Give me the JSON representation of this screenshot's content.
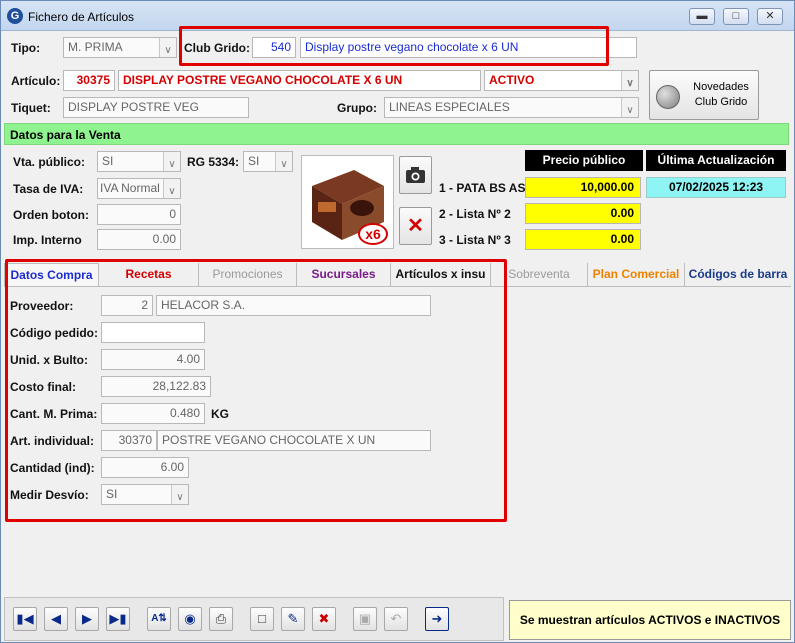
{
  "window": {
    "title": "Fichero de Artículos",
    "app_icon": "app-globe-icon"
  },
  "header": {
    "tipo_label": "Tipo:",
    "tipo_value": "M. PRIMA",
    "club_grido_label": "Club Grido:",
    "club_grido_code": "540",
    "club_grido_desc": "Display postre vegano chocolate x 6 UN"
  },
  "articulo": {
    "label": "Artículo:",
    "code": "30375",
    "description": "DISPLAY POSTRE VEGANO CHOCOLATE X 6 UN",
    "status": "ACTIVO",
    "tiquet_label": "Tiquet:",
    "tiquet_value": "DISPLAY POSTRE VEG",
    "grupo_label": "Grupo:",
    "grupo_value": "LINEAS ESPECIALES",
    "novedades_label": "Novedades Club Grido"
  },
  "venta": {
    "section_title": "Datos para la Venta",
    "vta_publico_label": "Vta. público:",
    "vta_publico_value": "SI",
    "rg_label": "RG 5334:",
    "rg_value": "SI",
    "iva_label": "Tasa de IVA:",
    "iva_value": "IVA Normal",
    "orden_label": "Orden boton:",
    "orden_value": "0",
    "imp_label": "Imp. Interno",
    "imp_value": "0.00",
    "photo_badge": "x6"
  },
  "precios": {
    "header_price": "Precio público",
    "header_update": "Última Actualización",
    "rows": [
      {
        "label": "1 - PATA BS AS",
        "value": "10,000.00"
      },
      {
        "label": "2 - Lista Nº 2",
        "value": "0.00"
      },
      {
        "label": "3 - Lista Nº 3",
        "value": "0.00"
      }
    ],
    "last_update": "07/02/2025 12:23"
  },
  "tabs": [
    {
      "label": "Datos Compra",
      "color": "#1a2cd0"
    },
    {
      "label": "Recetas",
      "color": "#d40000"
    },
    {
      "label": "Promociones",
      "color": "#9a9a9a"
    },
    {
      "label": "Sucursales",
      "color": "#7a1a8a"
    },
    {
      "label": "Artículos x insu",
      "color": "#111111"
    },
    {
      "label": "Sobreventa",
      "color": "#9a9a9a"
    },
    {
      "label": "Plan Comercial",
      "color": "#f08000"
    },
    {
      "label": "Códigos de barra",
      "color": "#1a3a8a"
    }
  ],
  "compra": {
    "proveedor_label": "Proveedor:",
    "proveedor_code": "2",
    "proveedor_name": "HELACOR S.A.",
    "codigo_pedido_label": "Código pedido:",
    "codigo_pedido_value": "",
    "unid_bulto_label": "Unid. x Bulto:",
    "unid_bulto_value": "4.00",
    "costo_final_label": "Costo final:",
    "costo_final_value": "28,122.83",
    "cant_mprima_label": "Cant. M. Prima:",
    "cant_mprima_value": "0.480",
    "cant_mprima_unit": "KG",
    "art_individual_label": "Art. individual:",
    "art_individual_code": "30370",
    "art_individual_name": "POSTRE VEGANO CHOCOLATE X UN",
    "cantidad_ind_label": "Cantidad (ind):",
    "cantidad_ind_value": "6.00",
    "medir_desvio_label": "Medir Desvío:",
    "medir_desvio_value": "SI"
  },
  "status_text": "Se muestran artículos ACTIVOS e INACTIVOS"
}
